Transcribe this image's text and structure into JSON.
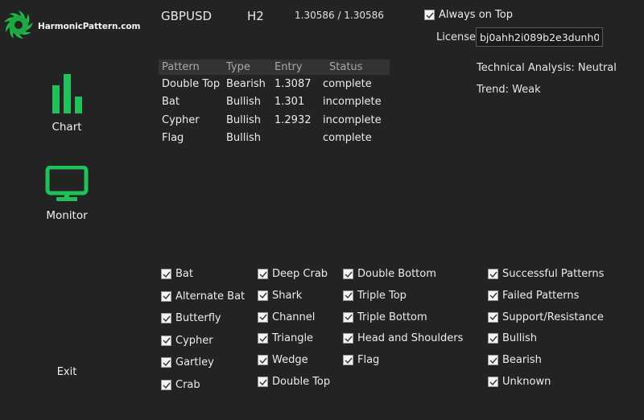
{
  "logo": {
    "text": "HarmonicPattern.com",
    "icon": "spiral-logo-icon",
    "color": "#21b84a"
  },
  "sidebar": {
    "items": [
      {
        "label": "Chart",
        "icon": "bar-chart-icon"
      },
      {
        "label": "Monitor",
        "icon": "monitor-icon"
      },
      {
        "label": "Exit"
      }
    ],
    "accent": "#21c15a"
  },
  "header": {
    "symbol": "GBPUSD",
    "timeframe": "H2",
    "prices": "1.30586 / 1.30586",
    "always_on_top": {
      "label": "Always on Top",
      "checked": true
    },
    "license": {
      "label": "License:",
      "value": "bj0ahh2i089b2e3dunh0"
    }
  },
  "analysis": {
    "technical": "Technical Analysis: Neutral",
    "trend": "Trend: Weak"
  },
  "table": {
    "columns": [
      "Pattern",
      "Type",
      "Entry",
      "Status"
    ],
    "rows": [
      [
        "Double Top",
        "Bearish",
        "1.3087",
        "complete"
      ],
      [
        "Bat",
        "Bullish",
        "1.301",
        "incomplete"
      ],
      [
        "Cypher",
        "Bullish",
        "1.2932",
        "incomplete"
      ],
      [
        "Flag",
        "Bullish",
        "",
        "complete"
      ]
    ]
  },
  "filters": {
    "col1": [
      {
        "label": "Bat",
        "checked": true
      },
      {
        "label": "Alternate Bat",
        "checked": true
      },
      {
        "label": "Butterfly",
        "checked": true
      },
      {
        "label": "Cypher",
        "checked": true
      },
      {
        "label": "Gartley",
        "checked": true
      },
      {
        "label": "Crab",
        "checked": true
      }
    ],
    "col2": [
      {
        "label": "Deep Crab",
        "checked": true
      },
      {
        "label": "Shark",
        "checked": true
      },
      {
        "label": "Channel",
        "checked": true
      },
      {
        "label": "Triangle",
        "checked": true
      },
      {
        "label": "Wedge",
        "checked": true
      },
      {
        "label": "Double Top",
        "checked": true
      }
    ],
    "col3": [
      {
        "label": "Double Bottom",
        "checked": true
      },
      {
        "label": "Triple Top",
        "checked": true
      },
      {
        "label": "Triple Bottom",
        "checked": true
      },
      {
        "label": "Head and Shoulders",
        "checked": true
      },
      {
        "label": "Flag",
        "checked": true
      }
    ],
    "col4": [
      {
        "label": "Successful Patterns",
        "checked": true
      },
      {
        "label": "Failed Patterns",
        "checked": true
      },
      {
        "label": "Support/Resistance",
        "checked": true
      },
      {
        "label": "Bullish",
        "checked": true
      },
      {
        "label": "Bearish",
        "checked": true
      },
      {
        "label": "Unknown",
        "checked": true
      }
    ]
  }
}
